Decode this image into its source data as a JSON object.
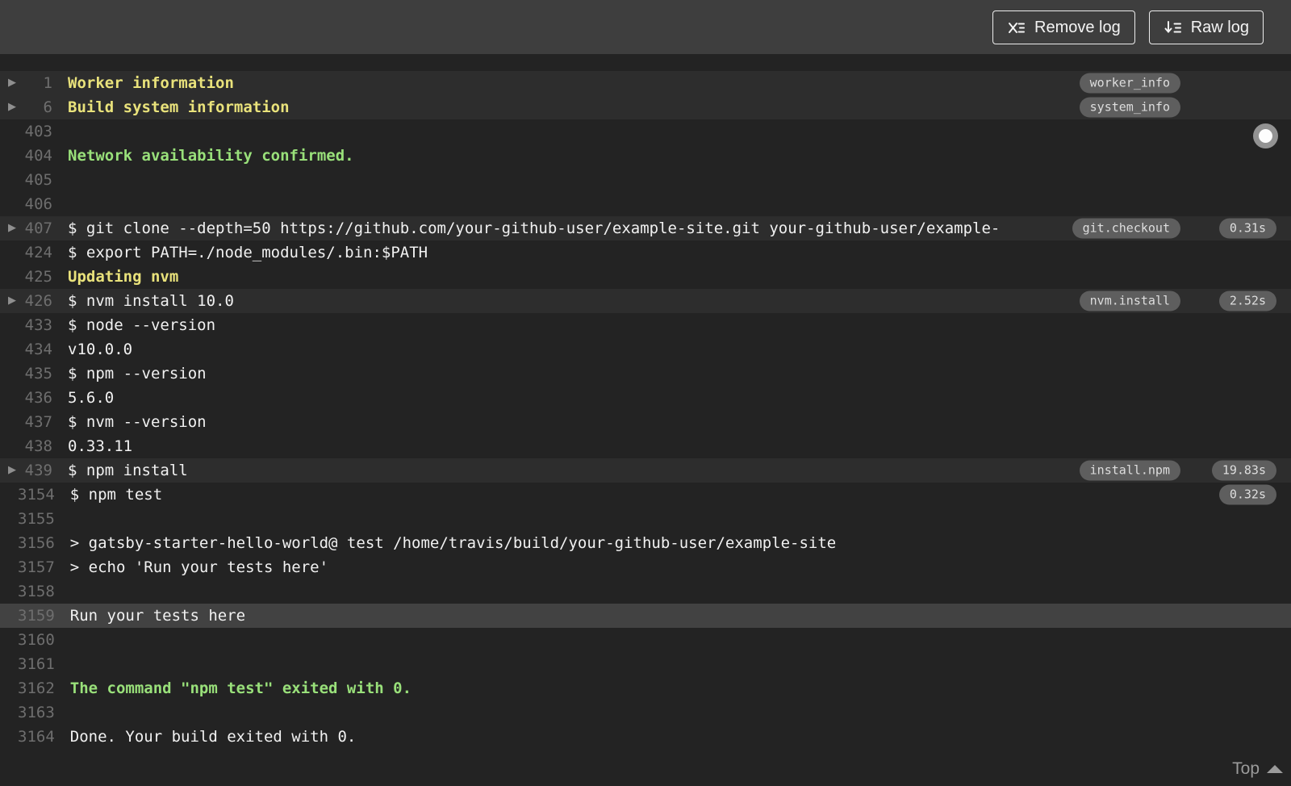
{
  "header": {
    "buttons": [
      {
        "label": "Remove log",
        "icon": "remove-log-icon"
      },
      {
        "label": "Raw log",
        "icon": "raw-log-icon"
      }
    ]
  },
  "log": {
    "follow_button": "follow-log-toggle",
    "top_link_label": "Top",
    "lines": [
      {
        "number": "1",
        "text": "Worker information",
        "color": "yellow",
        "fold": true,
        "tag": "worker_info"
      },
      {
        "number": "6",
        "text": "Build system information",
        "color": "yellow",
        "fold": true,
        "tag": "system_info"
      },
      {
        "number": "403",
        "text": ""
      },
      {
        "number": "404",
        "text": "Network availability confirmed.",
        "color": "green"
      },
      {
        "number": "405",
        "text": ""
      },
      {
        "number": "406",
        "text": ""
      },
      {
        "number": "407",
        "text": "$ git clone --depth=50 https://github.com/your-github-user/example-site.git your-github-user/example-",
        "fold": true,
        "tag": "git.checkout",
        "duration": "0.31s"
      },
      {
        "number": "424",
        "text": "$ export PATH=./node_modules/.bin:$PATH"
      },
      {
        "number": "425",
        "text": "Updating nvm",
        "color": "yellow"
      },
      {
        "number": "426",
        "text": "$ nvm install 10.0",
        "fold": true,
        "tag": "nvm.install",
        "duration": "2.52s"
      },
      {
        "number": "433",
        "text": "$ node --version"
      },
      {
        "number": "434",
        "text": "v10.0.0"
      },
      {
        "number": "435",
        "text": "$ npm --version"
      },
      {
        "number": "436",
        "text": "5.6.0"
      },
      {
        "number": "437",
        "text": "$ nvm --version"
      },
      {
        "number": "438",
        "text": "0.33.11"
      },
      {
        "number": "439",
        "text": "$ npm install",
        "fold": true,
        "tag": "install.npm",
        "duration": "19.83s"
      },
      {
        "number": "3154",
        "text": "$ npm test",
        "duration": "0.32s"
      },
      {
        "number": "3155",
        "text": ""
      },
      {
        "number": "3156",
        "text": "> gatsby-starter-hello-world@ test /home/travis/build/your-github-user/example-site"
      },
      {
        "number": "3157",
        "text": "> echo 'Run your tests here'"
      },
      {
        "number": "3158",
        "text": ""
      },
      {
        "number": "3159",
        "text": "Run your tests here",
        "highlight": true
      },
      {
        "number": "3160",
        "text": ""
      },
      {
        "number": "3161",
        "text": ""
      },
      {
        "number": "3162",
        "text": "The command \"npm test\" exited with 0.",
        "color": "green"
      },
      {
        "number": "3163",
        "text": ""
      },
      {
        "number": "3164",
        "text": "Done. Your build exited with 0."
      }
    ]
  },
  "colors": {
    "header_bg": "#3e3e3e",
    "log_bg": "#232323",
    "fold_row_bg": "#2d2d2d",
    "highlight_row_bg": "#424242",
    "fold_title": "#e9e27b",
    "success": "#99e07a",
    "text": "#f1f1f1",
    "line_number": "#6e6e6e",
    "badge_bg": "#5e5e5e"
  }
}
